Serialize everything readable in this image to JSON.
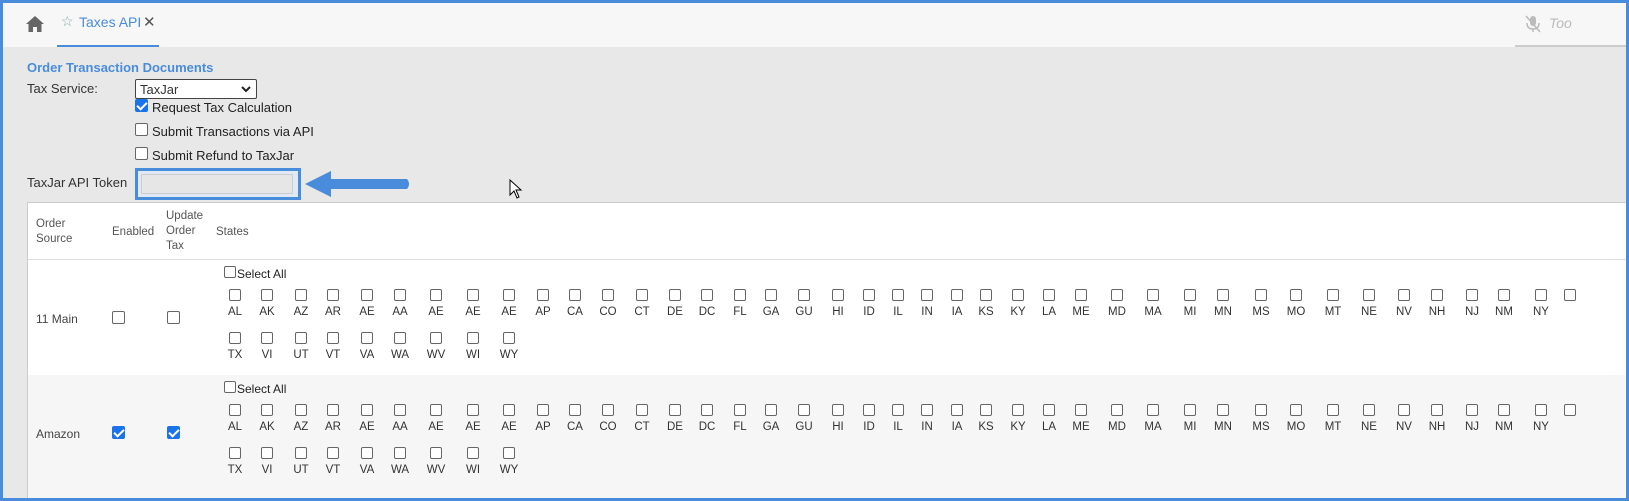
{
  "tabs": [
    {
      "label": "Taxes API",
      "active": true
    }
  ],
  "toolbar": {
    "right_text": "Too"
  },
  "section": {
    "title": "Order Transaction Documents"
  },
  "form": {
    "tax_service_label": "Tax Service:",
    "tax_service_value": "TaxJar",
    "options": [
      {
        "label": "Request Tax Calculation",
        "checked": true
      },
      {
        "label": "Submit Transactions via API",
        "checked": false
      },
      {
        "label": "Submit Refund to TaxJar",
        "checked": false
      }
    ],
    "token_label": "TaxJar API Token",
    "token_value": ""
  },
  "grid": {
    "headers": {
      "order_source": "Order Source",
      "enabled": "Enabled",
      "update_order_tax": "Update Order Tax",
      "states": "States"
    },
    "select_all_label": "Select All",
    "states_row1": [
      "AL",
      "AK",
      "AZ",
      "AR",
      "AE",
      "AA",
      "AE",
      "AE",
      "AE",
      "AP",
      "CA",
      "CO",
      "CT",
      "DE",
      "DC",
      "FL",
      "GA",
      "GU",
      "HI",
      "ID",
      "IL",
      "IN",
      "IA",
      "KS",
      "KY",
      "LA",
      "ME",
      "MD",
      "MA",
      "MI",
      "MN",
      "MS",
      "MO",
      "MT",
      "NE",
      "NV",
      "NH",
      "NJ",
      "NM",
      "NY"
    ],
    "states_row2": [
      "TX",
      "VI",
      "UT",
      "VT",
      "VA",
      "WA",
      "WV",
      "WI",
      "WY"
    ],
    "rows": [
      {
        "source": "11 Main",
        "enabled": false,
        "update_tax": false
      },
      {
        "source": "Amazon",
        "enabled": true,
        "update_tax": true
      }
    ]
  },
  "colors": {
    "accent": "#4a8cdc",
    "checkbox": "#1a73e8"
  }
}
